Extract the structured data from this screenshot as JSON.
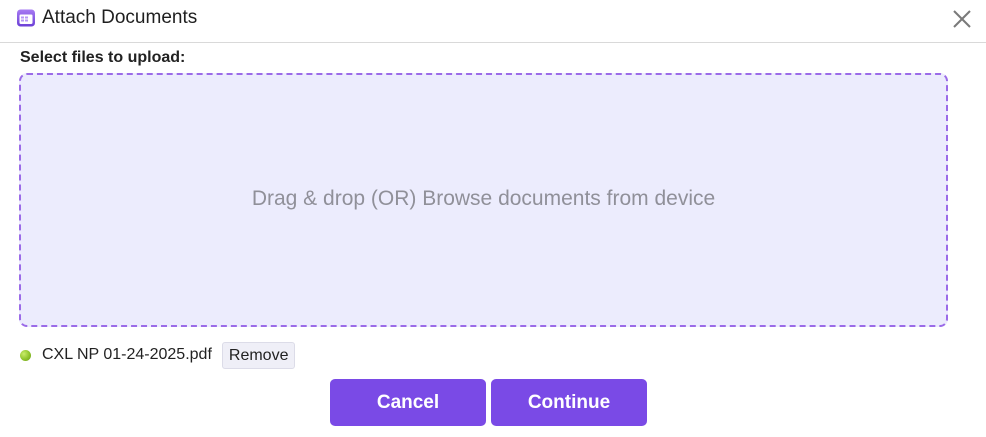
{
  "dialog": {
    "title": "Attach Documents",
    "title_icon": "calendar-window-icon",
    "close_icon": "close-icon"
  },
  "upload": {
    "label": "Select files to upload:",
    "dropzone_text": "Drag & drop (OR) Browse documents from device"
  },
  "files": [
    {
      "name": "CXL NP 01-24-2025.pdf",
      "status_color": "#8fc42c",
      "remove_label": "Remove"
    }
  ],
  "actions": {
    "cancel_label": "Cancel",
    "continue_label": "Continue"
  },
  "colors": {
    "accent": "#7a4ae6",
    "dropzone_bg": "#ececfd",
    "dropzone_border": "#9b6be8"
  }
}
